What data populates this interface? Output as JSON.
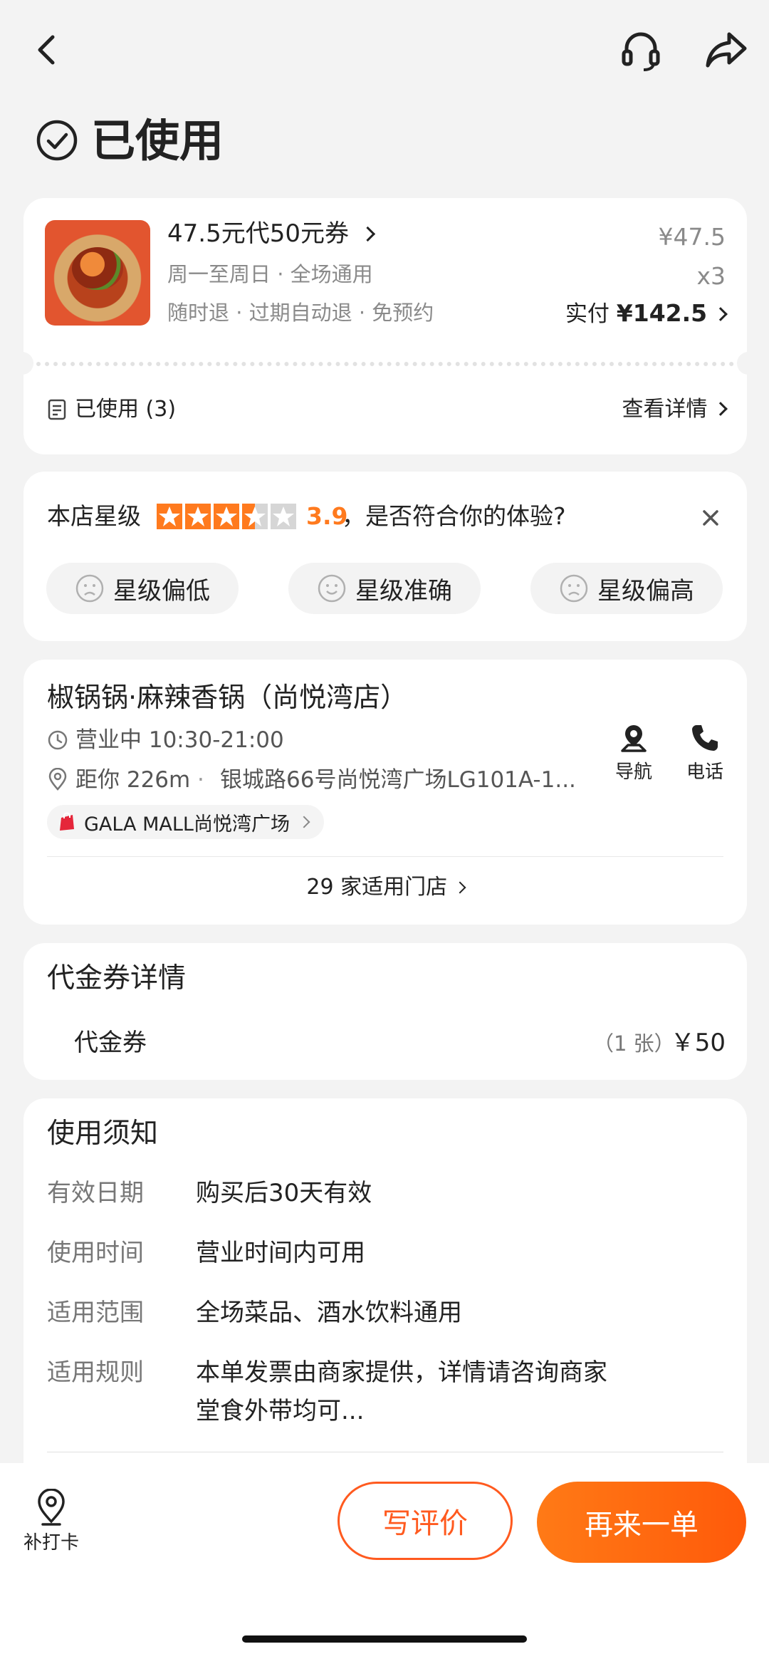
{
  "header": {
    "back_icon": "chevron-left-icon",
    "service_icon": "headset-icon",
    "share_icon": "share-arrow-icon"
  },
  "status": {
    "icon": "check-circle-icon",
    "text": "已使用"
  },
  "order": {
    "title": "47.5元代50元券",
    "line1": "周一至周日 · 全场通用",
    "line2": "随时退 · 过期自动退 · 免预约",
    "unit_price": "¥47.5",
    "qty": "x3",
    "paid_label": "实付",
    "paid_amount": "¥142.5",
    "used_label": "已使用 (3)",
    "detail_link": "查看详情"
  },
  "rating": {
    "label": "本店星级",
    "score": "3.9",
    "stars_value": 3.5,
    "question": "，是否符合你的体验?",
    "options": [
      "星级偏低",
      "星级准确",
      "星级偏高"
    ]
  },
  "store": {
    "name": "椒锅锅·麻辣香锅（尚悦湾店）",
    "hours": "营业中 10:30-21:00",
    "distance": "距你 226m",
    "address": "银城路66号尚悦湾广场LG101A-1...",
    "mall": "GALA MALL尚悦湾广场",
    "nav_label": "导航",
    "phone_label": "电话",
    "applicable": "29 家适用门店"
  },
  "voucher": {
    "title": "代金券详情",
    "name": "代金券",
    "count": "（1 张）",
    "price": "￥50"
  },
  "notice": {
    "title": "使用须知",
    "rows": [
      {
        "label": "有效日期",
        "value": "购买后30天有效"
      },
      {
        "label": "使用时间",
        "value": "营业时间内可用"
      },
      {
        "label": "适用范围",
        "value": "全场菜品、酒水饮料通用"
      },
      {
        "label": "适用规则",
        "value": "本单发票由商家提供，详情请咨询商家",
        "value2": "堂食外带均可..."
      }
    ]
  },
  "bottom": {
    "checkin_label": "补打卡",
    "review_button": "写评价",
    "reorder_button": "再来一单"
  },
  "colors": {
    "accent": "#ff6a12",
    "accent_text": "#ff5a1f",
    "star": "#ff7a1e"
  }
}
